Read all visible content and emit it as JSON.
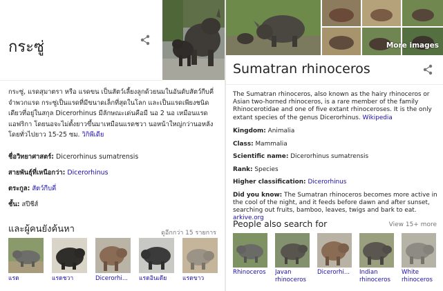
{
  "left_panel": {
    "title": "กระซู่",
    "description": "กระซู่, แรดสุมาตรา หรือ แรดขน เป็นสัตว์เลี้ยงลูกด้วยนมในอันดับสัตว์กีบคี่ จำพวกแรด กระซู่เป็นแรดที่มีขนาดเล็กที่สุดในโลก และเป็นแรดเพียงชนิดเดียวที่อยู่ในสกุล Dicerorhinus มีลักษณะเด่นคือมี นอ 2 นอ เหมือนแรดแอฟริกา โดยนอจะไม่ตั้งยาวขึ้นมาเหมือนแรดชวา นอหน้าใหญ่กว่านอหลัง โดยทั่วไปยาว 15-25 ซม.",
    "source_link": "วิกิพีเดีย",
    "facts": [
      {
        "label": "ชื่อวิทยาศาสตร์:",
        "value": "Dicerorhinus sumatrensis",
        "is_link": false
      },
      {
        "label": "สายพันธุ์ที่เหนือกว่า:",
        "value": "Dicerorhinus",
        "is_link": true
      },
      {
        "label": "ตระกูล:",
        "value": "สัตว์กีบคี่",
        "is_link": true
      },
      {
        "label": "ชั้น:",
        "value": "สปีชีส์",
        "is_link": false
      }
    ],
    "section_title": "และผู้คนยังค้นหา",
    "see_more": "ดูอีกกว่า 15 รายการ",
    "people_also_search": [
      {
        "label": "แรด",
        "icon": "rhino-photo"
      },
      {
        "label": "แรดชวา",
        "icon": "rhino-photo"
      },
      {
        "label": "Dicerorhi...",
        "icon": "rhino-photo"
      },
      {
        "label": "แรดอินเดีย",
        "icon": "rhino-photo"
      },
      {
        "label": "แรดขาว",
        "icon": "rhino-photo"
      }
    ]
  },
  "right_panel": {
    "more_images": "More images",
    "title": "Sumatran rhinoceros",
    "description": "The Sumatran rhinoceros, also known as the hairy rhinoceros or Asian two-horned rhinoceros, is a rare member of the family Rhinocerotidae and one of five extant rhinoceroses. It is the only extant species of the genus Dicerorhinus.",
    "source_link": "Wikipedia",
    "facts": {
      "kingdom": {
        "label": "Kingdom:",
        "value": "Animalia"
      },
      "class": {
        "label": "Class:",
        "value": "Mammalia"
      },
      "scientific_name": {
        "label": "Scientific name:",
        "value": "Dicerorhinus sumatrensis"
      },
      "rank": {
        "label": "Rank:",
        "value": "Species"
      },
      "higher_classification": {
        "label": "Higher classification:",
        "value": "Dicerorhinus"
      },
      "did_you_know": {
        "label": "Did you know:",
        "value": "The Sumatran rhinoceros becomes more active in the cool of the night, and it feeds before dawn and after sunset, searching out fruits, bamboo, leaves, twigs and bark to eat.",
        "link": "arkive.org"
      }
    },
    "section_title": "People also search for",
    "view_more": "View 15+ more",
    "people_also_search": [
      {
        "label": "Rhinoceros",
        "icon": "rhino-photo"
      },
      {
        "label": "Javan rhinoceros",
        "icon": "rhino-photo"
      },
      {
        "label": "Dicerorhi...",
        "icon": "rhino-photo"
      },
      {
        "label": "Indian rhinoceros",
        "icon": "rhino-photo"
      },
      {
        "label": "White rhinoceros",
        "icon": "rhino-photo"
      }
    ]
  },
  "colors": {
    "link": "#1a0dab",
    "muted": "#70757a",
    "text": "#222222"
  }
}
